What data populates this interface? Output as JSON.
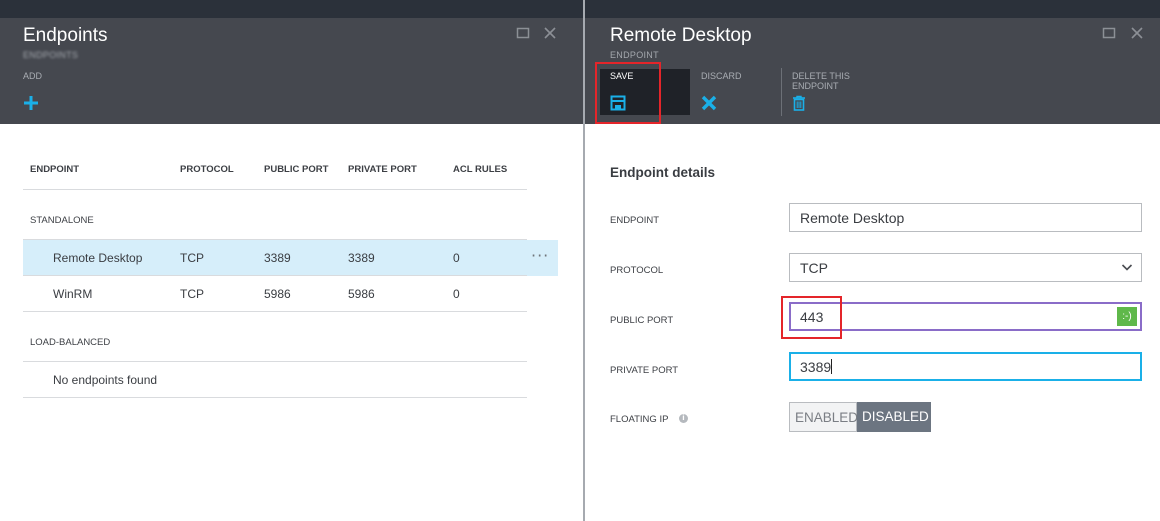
{
  "left": {
    "title": "Endpoints",
    "subtitle": "ENDPOINTS",
    "command": {
      "label": "ADD",
      "icon": "plus-icon"
    },
    "columns": [
      "ENDPOINT",
      "PROTOCOL",
      "PUBLIC PORT",
      "PRIVATE PORT",
      "ACL RULES"
    ],
    "groups": {
      "standalone": {
        "label": "STANDALONE",
        "rows": [
          {
            "endpoint": "Remote Desktop",
            "protocol": "TCP",
            "public_port": "3389",
            "private_port": "3389",
            "acl_rules": "0",
            "more": "···"
          },
          {
            "endpoint": "WinRM",
            "protocol": "TCP",
            "public_port": "5986",
            "private_port": "5986",
            "acl_rules": "0"
          }
        ]
      },
      "load_balanced": {
        "label": "LOAD-BALANCED",
        "empty_text": "No endpoints found"
      }
    }
  },
  "right": {
    "title": "Remote Desktop",
    "subtitle": "ENDPOINT",
    "commands": {
      "save": {
        "label": "SAVE",
        "icon": "save-icon"
      },
      "discard": {
        "label": "DISCARD",
        "icon": "close-x-icon"
      },
      "delete": {
        "label_line1": "DELETE THIS",
        "label_line2": "ENDPOINT",
        "icon": "trash-icon"
      }
    },
    "section_title": "Endpoint details",
    "fields": {
      "endpoint": {
        "label": "ENDPOINT",
        "value": "Remote Desktop"
      },
      "protocol": {
        "label": "PROTOCOL",
        "value": "TCP"
      },
      "public_port": {
        "label": "PUBLIC PORT",
        "value": "443",
        "badge": ":-)"
      },
      "private_port": {
        "label": "PRIVATE PORT",
        "value": "3389"
      },
      "floating_ip": {
        "label": "FLOATING IP",
        "options": [
          "ENABLED",
          "DISABLED"
        ],
        "selected": "DISABLED"
      }
    }
  },
  "colors": {
    "header_bg": "#45484f",
    "accent": "#1ab0e8",
    "highlight": "#e4252a",
    "selected_row": "#d6eefa",
    "valid_badge": "#5fb84a"
  }
}
